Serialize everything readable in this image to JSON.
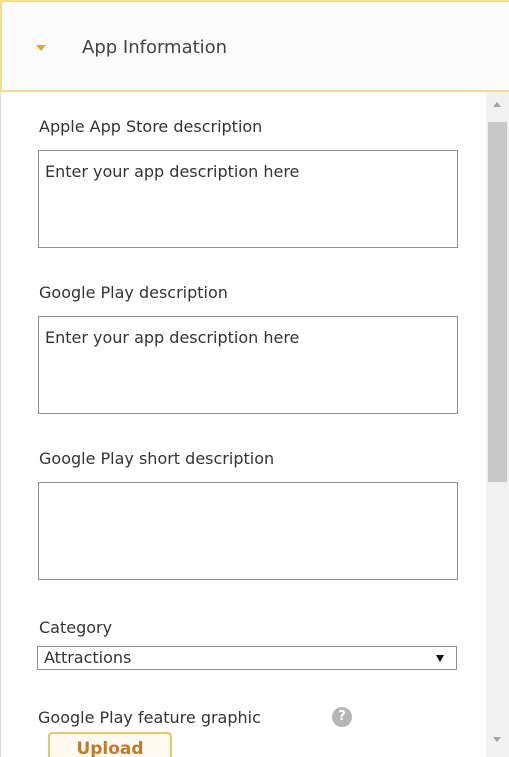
{
  "panel": {
    "title": "App Information",
    "caret_icon": "caret-down-icon",
    "accent_color": "#e9a23b"
  },
  "fields": {
    "apple_description": {
      "label": "Apple App Store description",
      "value": "Enter your app description here"
    },
    "google_description": {
      "label": "Google Play description",
      "value": "Enter your app description here"
    },
    "google_short_description": {
      "label": "Google Play short description",
      "value": ""
    },
    "category": {
      "label": "Category",
      "selected": "Attractions"
    },
    "feature_graphic": {
      "label": "Google Play feature graphic",
      "help_icon": "help-icon",
      "help_glyph": "?",
      "upload_label": "Upload"
    }
  },
  "colors": {
    "header_border": "#f3dc8b",
    "upload_text": "#c07a2c"
  }
}
